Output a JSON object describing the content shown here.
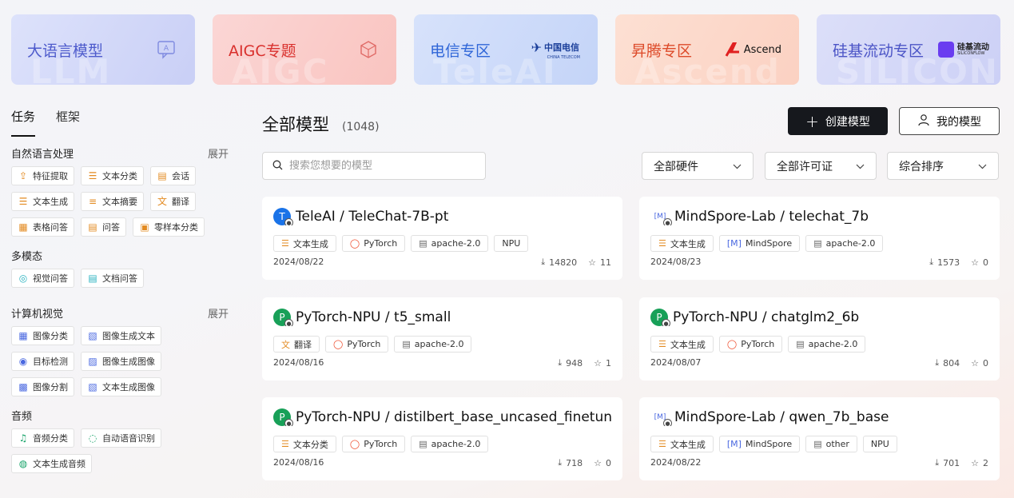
{
  "banners": [
    {
      "title": "大语言模型",
      "bg": "LLM"
    },
    {
      "title": "AIGC专题",
      "bg": "AIGC"
    },
    {
      "title": "电信专区",
      "bg": "TeleAI",
      "logo": "中国电信",
      "logo_sub": "CHINA TELECOM"
    },
    {
      "title": "昇腾专区",
      "bg": "Ascend",
      "logo": "Ascend"
    },
    {
      "title": "硅基流动专区",
      "bg": "SILICON",
      "logo": "硅基流动",
      "logo_sub": "SILICONFLOW"
    }
  ],
  "side_tabs": [
    "任务",
    "框架"
  ],
  "expand_label": "展开",
  "categories": [
    {
      "name": "自然语言处理",
      "items": [
        {
          "label": "特征提取",
          "icon": "feature-extract-icon"
        },
        {
          "label": "文本分类",
          "icon": "text-classify-icon"
        },
        {
          "label": "会话",
          "icon": "chat-icon"
        },
        {
          "label": "文本生成",
          "icon": "text-gen-icon"
        },
        {
          "label": "文本摘要",
          "icon": "summary-icon"
        },
        {
          "label": "翻译",
          "icon": "translate-icon"
        },
        {
          "label": "表格问答",
          "icon": "table-qa-icon"
        },
        {
          "label": "问答",
          "icon": "qa-icon"
        },
        {
          "label": "零样本分类",
          "icon": "zero-shot-icon"
        }
      ]
    },
    {
      "name": "多模态",
      "items": [
        {
          "label": "视觉问答",
          "icon": "visual-qa-icon"
        },
        {
          "label": "文档问答",
          "icon": "doc-qa-icon"
        }
      ]
    },
    {
      "name": "计算机视觉",
      "items": [
        {
          "label": "图像分类",
          "icon": "image-classify-icon"
        },
        {
          "label": "图像生成文本",
          "icon": "image-to-text-icon"
        },
        {
          "label": "目标检测",
          "icon": "object-detect-icon"
        },
        {
          "label": "图像生成图像",
          "icon": "image-to-image-icon"
        },
        {
          "label": "图像分割",
          "icon": "image-segment-icon"
        },
        {
          "label": "文本生成图像",
          "icon": "text-to-image-icon"
        }
      ]
    },
    {
      "name": "音频",
      "items": [
        {
          "label": "音频分类",
          "icon": "audio-classify-icon"
        },
        {
          "label": "自动语音识别",
          "icon": "asr-icon"
        },
        {
          "label": "文本生成音频",
          "icon": "tts-icon"
        }
      ]
    }
  ],
  "main": {
    "title": "全部模型",
    "count": "(1048)",
    "create_label": "创建模型",
    "my_label": "我的模型",
    "search_placeholder": "搜索您想要的模型",
    "filters": [
      "全部硬件",
      "全部许可证",
      "综合排序"
    ]
  },
  "cards": [
    {
      "owner": "TeleAI",
      "name": "TeleAI / TeleChat-7B-pt",
      "avatar": "T",
      "tags": [
        "文本生成",
        "PyTorch",
        "apache-2.0",
        "NPU"
      ],
      "date": "2024/08/22",
      "downloads": "14820",
      "stars": "11"
    },
    {
      "owner": "MindSpore",
      "name": "MindSpore-Lab / telechat_7b",
      "avatar": "M",
      "tags": [
        "文本生成",
        "MindSpore",
        "apache-2.0"
      ],
      "date": "2024/08/23",
      "downloads": "1573",
      "stars": "0"
    },
    {
      "owner": "PyTorch",
      "name": "PyTorch-NPU / t5_small",
      "avatar": "P",
      "tags": [
        "翻译",
        "PyTorch",
        "apache-2.0"
      ],
      "date": "2024/08/16",
      "downloads": "948",
      "stars": "1"
    },
    {
      "owner": "PyTorch",
      "name": "PyTorch-NPU / chatglm2_6b",
      "avatar": "P",
      "tags": [
        "文本生成",
        "PyTorch",
        "apache-2.0"
      ],
      "date": "2024/08/07",
      "downloads": "804",
      "stars": "0"
    },
    {
      "owner": "PyTorch",
      "name": "PyTorch-NPU / distilbert_base_uncased_finetuned_...",
      "avatar": "P",
      "tags": [
        "文本分类",
        "PyTorch",
        "apache-2.0"
      ],
      "date": "2024/08/16",
      "downloads": "718",
      "stars": "0"
    },
    {
      "owner": "MindSpore",
      "name": "MindSpore-Lab / qwen_7b_base",
      "avatar": "M",
      "tags": [
        "文本生成",
        "MindSpore",
        "other",
        "NPU"
      ],
      "date": "2024/08/22",
      "downloads": "701",
      "stars": "2"
    }
  ]
}
